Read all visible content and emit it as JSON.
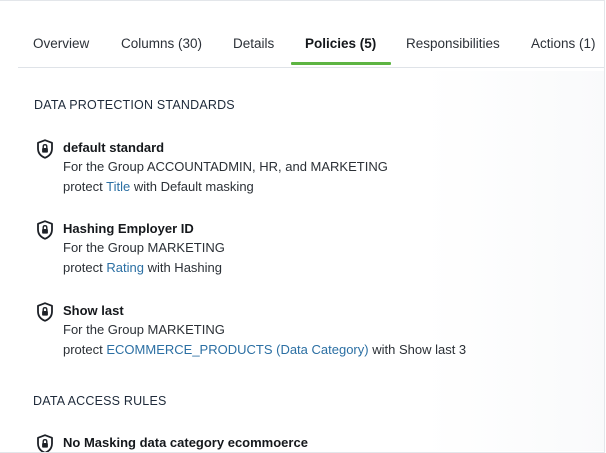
{
  "tabs": [
    {
      "label": "Overview"
    },
    {
      "label": "Columns (30)"
    },
    {
      "label": "Details"
    },
    {
      "label": "Policies (5)"
    },
    {
      "label": "Responsibilities"
    },
    {
      "label": "Actions (1)"
    }
  ],
  "active_tab": "Policies (5)",
  "accent_color": "#5db442",
  "link_color": "#2b6fa3",
  "data_protection": {
    "title": "DATA PROTECTION STANDARDS",
    "policies": [
      {
        "icon": "shield-lock-icon",
        "name": "default standard",
        "group_line": "For the Group ACCOUNTADMIN, HR, and MARKETING",
        "protect_prefix": "protect",
        "protect_target": "Title",
        "protect_suffix": "with Default masking"
      },
      {
        "icon": "shield-lock-icon",
        "name": "Hashing Employer ID",
        "group_line": "For the Group MARKETING",
        "protect_prefix": "protect",
        "protect_target": "Rating",
        "protect_suffix": "with Hashing"
      },
      {
        "icon": "shield-lock-icon",
        "name": "Show last",
        "group_line": "For the Group MARKETING",
        "protect_prefix": "protect",
        "protect_target": "ECOMMERCE_PRODUCTS (Data Category)",
        "protect_suffix": "with Show last 3"
      }
    ]
  },
  "data_access": {
    "title": "DATA ACCESS RULES",
    "rules": [
      {
        "icon": "shield-lock-icon",
        "name": "No Masking data category ecommoerce"
      }
    ]
  }
}
